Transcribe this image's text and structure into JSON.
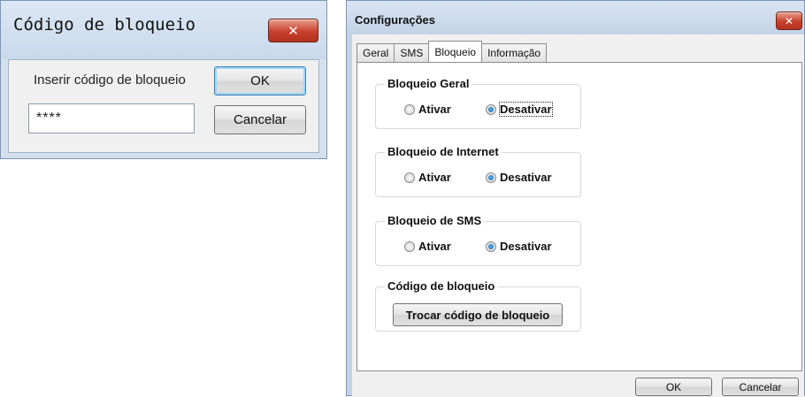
{
  "lock_dialog": {
    "title": "Código de bloqueio",
    "prompt": "Inserir código de bloqueio",
    "code_value": "****",
    "ok_label": "OK",
    "cancel_label": "Cancelar",
    "close_glyph": "✕"
  },
  "config_dialog": {
    "title": "Configurações",
    "close_glyph": "✕",
    "tabs": [
      "Geral",
      "SMS",
      "Bloqueio",
      "Informação"
    ],
    "active_tab": "Bloqueio",
    "groups": [
      {
        "title": "Bloqueio Geral",
        "option_on": "Ativar",
        "option_off": "Desativar",
        "selected": "Desativar"
      },
      {
        "title": "Bloqueio de Internet",
        "option_on": "Ativar",
        "option_off": "Desativar",
        "selected": "Desativar"
      },
      {
        "title": "Bloqueio de SMS",
        "option_on": "Ativar",
        "option_off": "Desativar",
        "selected": "Desativar"
      }
    ],
    "code_group": {
      "title": "Código de bloqueio",
      "button_label": "Trocar código de bloqueio"
    },
    "ok_label": "OK",
    "cancel_label": "Cancelar"
  },
  "colors": {
    "title_bar": "#c9d9ec",
    "close_button": "#c7402d",
    "window_body": "#f0f0f0",
    "radio_selected": "#1b62a8"
  }
}
